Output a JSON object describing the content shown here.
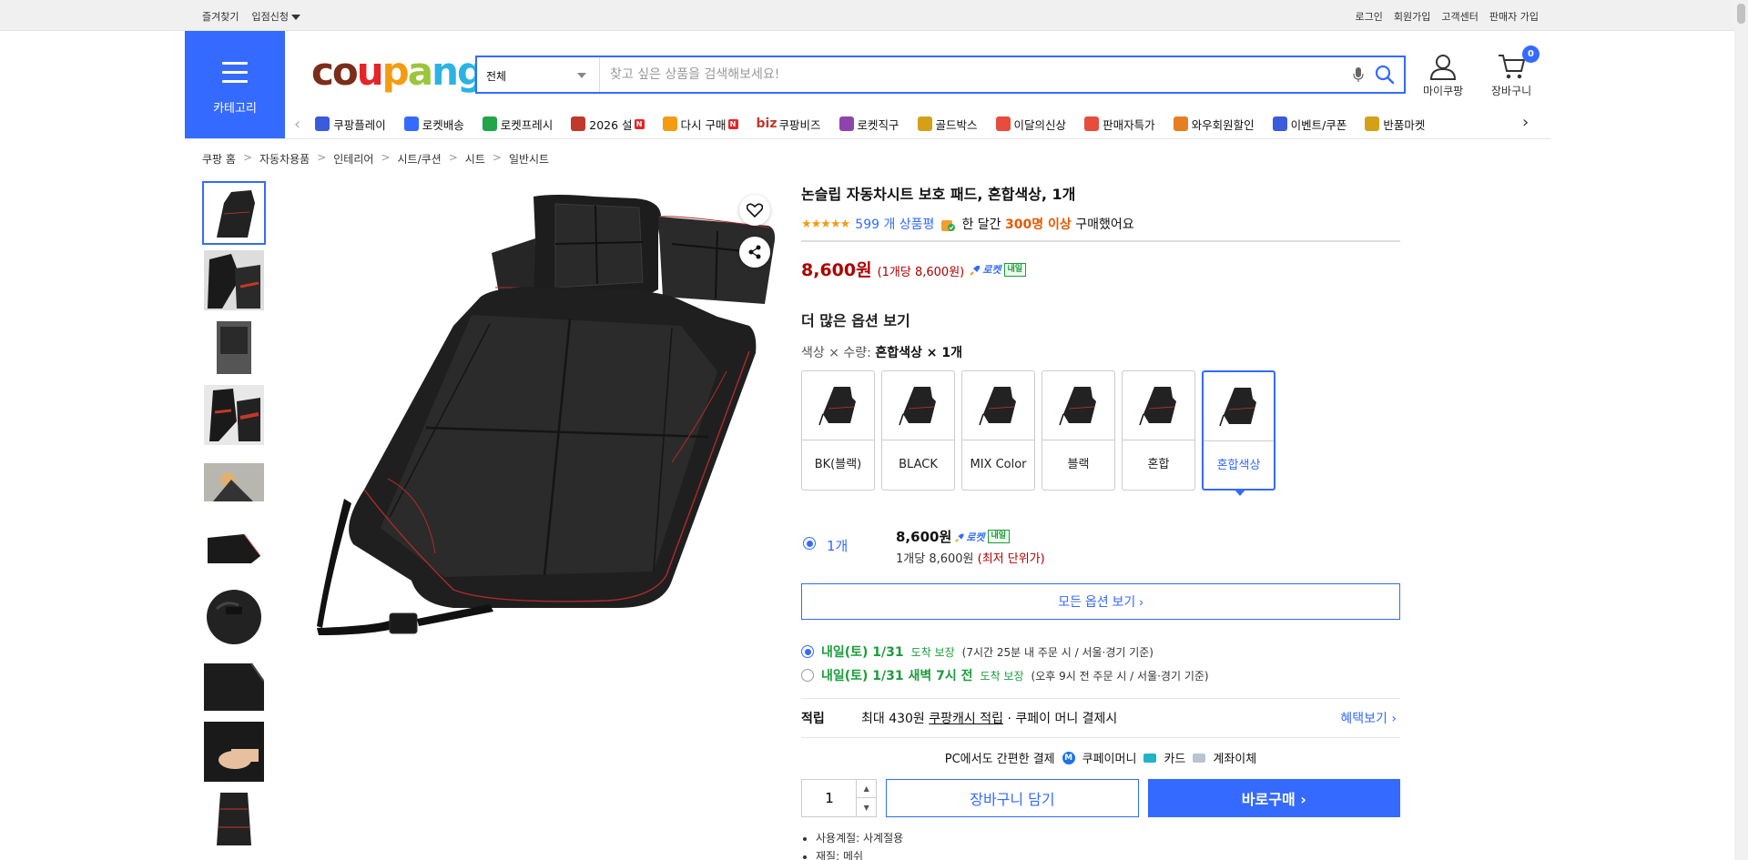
{
  "topbar": {
    "left": [
      "즐겨찾기",
      "입점신청"
    ],
    "right": [
      "로그인",
      "회원가입",
      "고객센터",
      "판매자 가입"
    ]
  },
  "header": {
    "category_label": "카테고리",
    "logo": "coupang",
    "search_select": "전체",
    "search_placeholder": "찾고 싶은 상품을 검색해보세요!",
    "mycoupang": "마이쿠팡",
    "cart": "장바구니",
    "cart_count": "0"
  },
  "subnav": [
    {
      "label": "쿠팡플레이",
      "color": "#3b5bdb"
    },
    {
      "label": "로켓배송",
      "color": "#346aff"
    },
    {
      "label": "로켓프레시",
      "color": "#22a548"
    },
    {
      "label": "2026 설",
      "color": "#c0392b",
      "badge": "N"
    },
    {
      "label": "다시 구매",
      "color": "#f39c12",
      "badge": "N"
    },
    {
      "label": "쿠팡비즈",
      "color": "#c0392b",
      "prefix": "biz"
    },
    {
      "label": "로켓직구",
      "color": "#8e44ad"
    },
    {
      "label": "골드박스",
      "color": "#d4a017"
    },
    {
      "label": "이달의신상",
      "color": "#e74c3c"
    },
    {
      "label": "판매자특가",
      "color": "#e74c3c"
    },
    {
      "label": "와우회원할인",
      "color": "#e67e22"
    },
    {
      "label": "이벤트/쿠폰",
      "color": "#3b5bdb"
    },
    {
      "label": "반품마켓",
      "color": "#d4a017"
    }
  ],
  "breadcrumb": [
    "쿠팡 홈",
    "자동차용품",
    "인테리어",
    "시트/쿠션",
    "시트",
    "일반시트"
  ],
  "product": {
    "title": "논슬립 자동차시트 보호 패드, 혼합색상, 1개",
    "stars": "★★★★★",
    "reviews": "599 개 상품평",
    "sold_pre": "한 달간",
    "sold_count": "300명 이상",
    "sold_post": "구매했어요",
    "price": "8,600원",
    "unit_price": "(1개당 8,600원)",
    "rocket": "로켓",
    "rocket_tag": "내일",
    "more_options": "더 많은 옵션 보기",
    "option_label": "색상 × 수량:",
    "option_value": "혼합색상 × 1개",
    "options": [
      "BK(블랙)",
      "BLACK",
      "MIX Color",
      "블랙",
      "혼합",
      "혼합색상"
    ],
    "selected_option_index": 5,
    "qty_option": "1개",
    "qty_price": "8,600원",
    "qty_unit": "1개당 8,600원",
    "qty_lowest": "(최저 단위가)",
    "all_options": "모든 옵션 보기 ›",
    "delivery": [
      {
        "day": "내일(토) 1/31",
        "tag": "도착 보장",
        "note": "(7시간 25분 내 주문 시 / 서울·경기 기준)",
        "selected": true
      },
      {
        "day": "내일(토) 1/31 새벽 7시 전",
        "tag": "도착 보장",
        "note": "(오후 9시 전 주문 시 / 서울·경기 기준)",
        "selected": false
      }
    ],
    "reward_label": "적립",
    "reward_pre": "최대 430원",
    "reward_link": "쿠팡캐시 적립",
    "reward_post": "· 쿠페이 머니 결제시",
    "reward_more": "혜택보기 ›",
    "pay_label": "PC에서도 간편한 결제",
    "pay_methods": [
      "쿠페이머니",
      "카드",
      "계좌이체"
    ],
    "quantity": "1",
    "btn_cart": "장바구니 담기",
    "btn_buy": "바로구매 ›",
    "attrs": [
      "사용계절: 사계절용",
      "재질: 메쉬"
    ]
  }
}
